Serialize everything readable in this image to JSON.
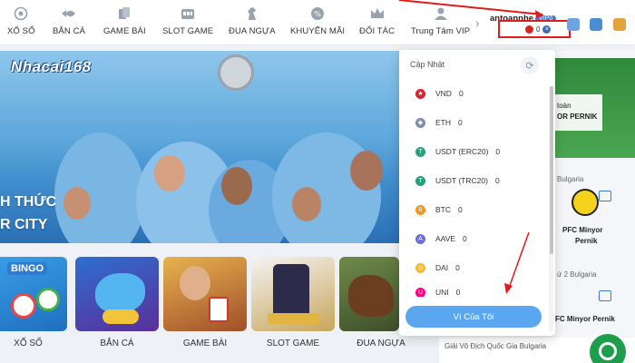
{
  "nav": {
    "items": [
      {
        "label": "XỔ SỐ",
        "icon": "lottery-icon"
      },
      {
        "label": "BẮN CÁ",
        "icon": "fish-icon"
      },
      {
        "label": "GAME BÀI",
        "icon": "cards-icon"
      },
      {
        "label": "SLOT GAME",
        "icon": "slot-icon"
      },
      {
        "label": "ĐUA NGỰA",
        "icon": "horse-icon"
      },
      {
        "label": "KHUYẾN MÃI",
        "icon": "percent-icon"
      },
      {
        "label": "ĐỐI TÁC",
        "icon": "crown-icon"
      },
      {
        "label": "Trung Tâm VIP",
        "icon": "user-icon"
      }
    ]
  },
  "user": {
    "name": "antoannhe",
    "vip": "VIP0",
    "balance": "0"
  },
  "banner": {
    "logo": "Nhacai168",
    "line1": "H THỨC",
    "line2": "R CITY"
  },
  "tiles": [
    {
      "label": "XỔ SỐ",
      "art": "BINGO"
    },
    {
      "label": "BẮN CÁ"
    },
    {
      "label": "GAME BÀI"
    },
    {
      "label": "SLOT GAME"
    },
    {
      "label": "ĐUA NGỰA"
    }
  ],
  "wallet": {
    "title": "Cập Nhật",
    "coins": [
      {
        "name": "VND",
        "value": "0",
        "color": "#d8232a"
      },
      {
        "name": "ETH",
        "value": "0",
        "color": "#7b8fb0"
      },
      {
        "name": "USDT (ERC20)",
        "value": "0",
        "color": "#26a17b"
      },
      {
        "name": "USDT (TRC20)",
        "value": "0",
        "color": "#26a17b"
      },
      {
        "name": "BTC",
        "value": "0",
        "color": "#f7931a"
      },
      {
        "name": "AAVE",
        "value": "0",
        "color": "#6b6fd8"
      },
      {
        "name": "DAI",
        "value": "0",
        "color": "#f4b731"
      },
      {
        "name": "UNI",
        "value": "0",
        "color": "#ff007a"
      }
    ],
    "button": "Ví Của Tôi"
  },
  "right": {
    "t1": "toàn",
    "t2": "OR PERNIK",
    "t3": "Bulgaria",
    "t4": "PFC Minyor",
    "t5": "Pernik",
    "t6": "ứ 2 Bulgaria",
    "t7": "FC Minyor Pernik",
    "t8": "Giải Vô Địch Quốc Gia Bulgaria"
  },
  "colors": {
    "accent": "#5aa7ef",
    "highlight_box": "#e11b1b",
    "nav_bg": "#ffffff",
    "chat": "#1e9e4c"
  }
}
